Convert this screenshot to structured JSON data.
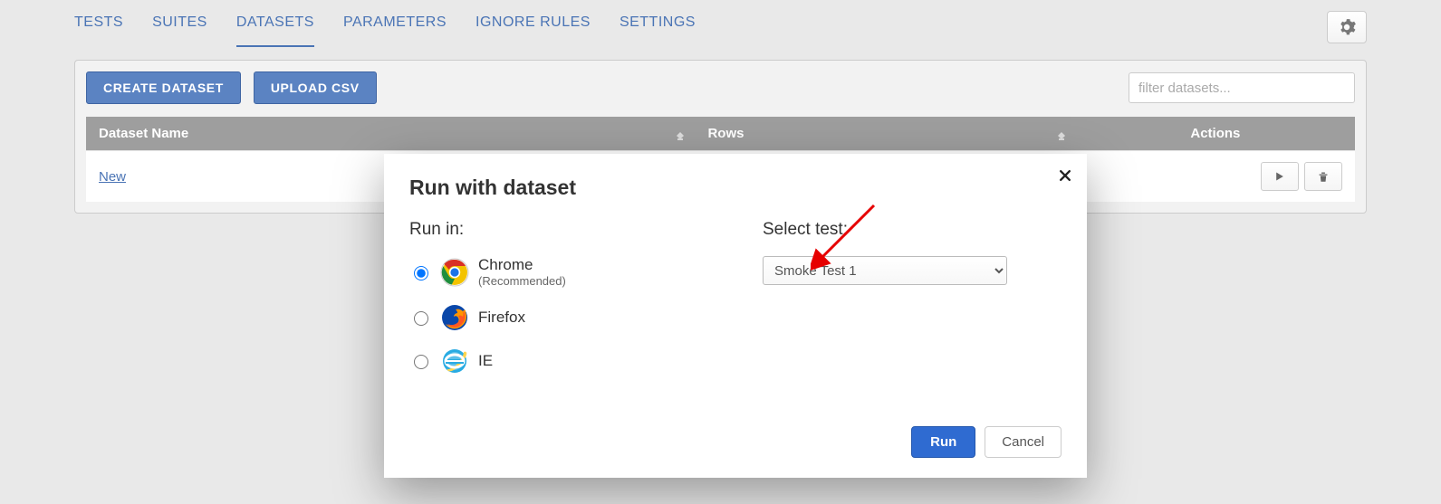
{
  "nav": {
    "tabs": [
      "TESTS",
      "SUITES",
      "DATASETS",
      "PARAMETERS",
      "IGNORE RULES",
      "SETTINGS"
    ],
    "active": "DATASETS"
  },
  "toolbar": {
    "create_label": "CREATE DATASET",
    "upload_label": "UPLOAD CSV",
    "filter_placeholder": "filter datasets..."
  },
  "table": {
    "headers": {
      "name": "Dataset Name",
      "rows": "Rows",
      "actions": "Actions"
    },
    "rows": [
      {
        "name": "New",
        "rows": ""
      }
    ]
  },
  "modal": {
    "title": "Run with dataset",
    "run_in_label": "Run in:",
    "select_test_label": "Select test:",
    "browsers": [
      {
        "key": "chrome",
        "name": "Chrome",
        "hint": "(Recommended)",
        "checked": true
      },
      {
        "key": "firefox",
        "name": "Firefox",
        "hint": "",
        "checked": false
      },
      {
        "key": "ie",
        "name": "IE",
        "hint": "",
        "checked": false
      }
    ],
    "selected_test": "Smoke Test 1",
    "run_label": "Run",
    "cancel_label": "Cancel"
  }
}
